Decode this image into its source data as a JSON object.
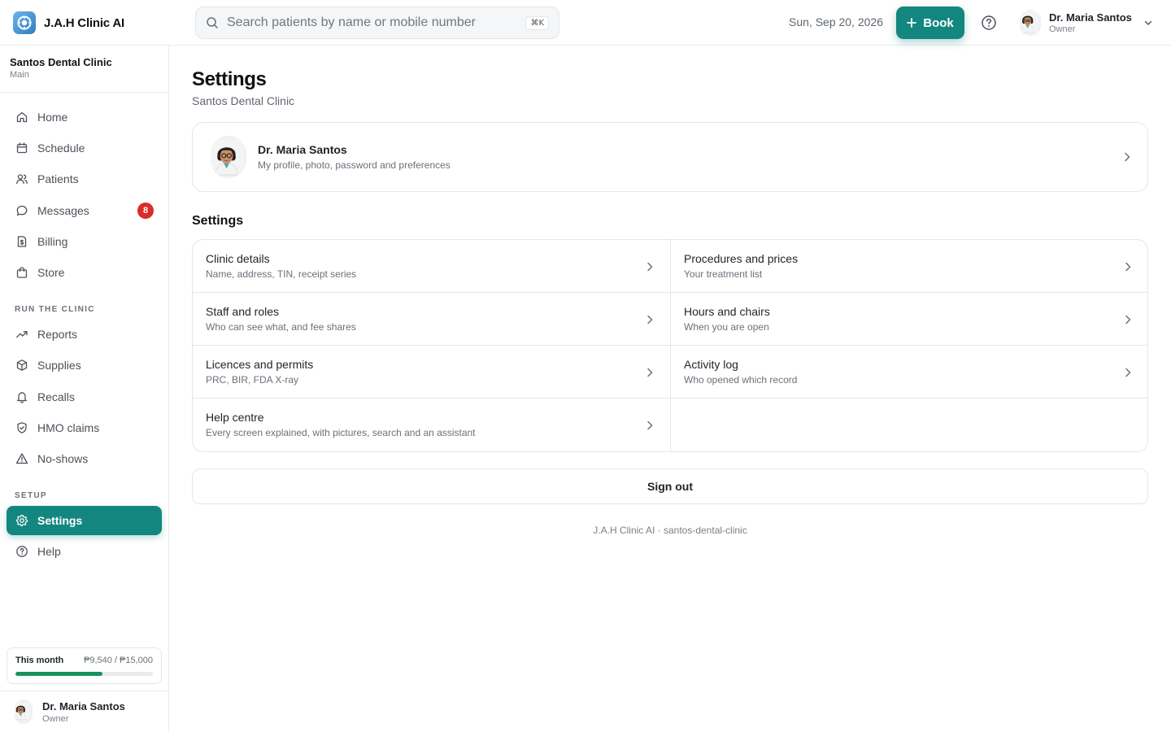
{
  "brand": {
    "name": "J.A.H Clinic AI"
  },
  "search": {
    "placeholder": "Search patients by name or mobile number",
    "shortcut": "⌘K"
  },
  "header": {
    "date": "Sun, Sep 20, 2026",
    "book_label": "Book",
    "user_name": "Dr. Maria Santos",
    "user_role": "Owner"
  },
  "sidebar": {
    "clinic_name": "Santos Dental Clinic",
    "clinic_branch": "Main",
    "items": [
      {
        "label": "Home",
        "icon": "home-icon"
      },
      {
        "label": "Schedule",
        "icon": "calendar-icon"
      },
      {
        "label": "Patients",
        "icon": "users-icon"
      },
      {
        "label": "Messages",
        "icon": "message-icon",
        "badge": "8"
      },
      {
        "label": "Billing",
        "icon": "receipt-icon"
      },
      {
        "label": "Store",
        "icon": "shopping-bag-icon"
      }
    ],
    "section_run": "RUN THE CLINIC",
    "run_items": [
      {
        "label": "Reports",
        "icon": "trending-up-icon"
      },
      {
        "label": "Supplies",
        "icon": "box-icon"
      },
      {
        "label": "Recalls",
        "icon": "bell-icon"
      },
      {
        "label": "HMO claims",
        "icon": "shield-check-icon"
      },
      {
        "label": "No-shows",
        "icon": "warning-icon"
      }
    ],
    "section_setup": "SETUP",
    "setup_items": [
      {
        "label": "Settings",
        "icon": "gear-icon",
        "active": true
      },
      {
        "label": "Help",
        "icon": "help-circle-icon"
      }
    ],
    "month": {
      "label": "This month",
      "value": "₱9,540 / ₱15,000",
      "progress": 0.636
    },
    "user_name": "Dr. Maria Santos",
    "user_role": "Owner"
  },
  "main": {
    "title": "Settings",
    "subtitle": "Santos Dental Clinic",
    "profile": {
      "name": "Dr. Maria Santos",
      "description": "My profile, photo, password and preferences"
    },
    "section_title": "Settings",
    "settings": [
      {
        "title": "Clinic details",
        "description": "Name, address, TIN, receipt series"
      },
      {
        "title": "Procedures and prices",
        "description": "Your treatment list"
      },
      {
        "title": "Staff and roles",
        "description": "Who can see what, and fee shares"
      },
      {
        "title": "Hours and chairs",
        "description": "When you are open"
      },
      {
        "title": "Licences and permits",
        "description": "PRC, BIR, FDA X-ray"
      },
      {
        "title": "Activity log",
        "description": "Who opened which record"
      },
      {
        "title": "Help centre",
        "description": "Every screen explained, with pictures, search and an assistant"
      }
    ],
    "signout_label": "Sign out",
    "footer": "J.A.H Clinic AI · santos-dental-clinic"
  },
  "colors": {
    "accent": "#13877f",
    "badge": "#dc2b2b",
    "progress": "#17925f"
  }
}
